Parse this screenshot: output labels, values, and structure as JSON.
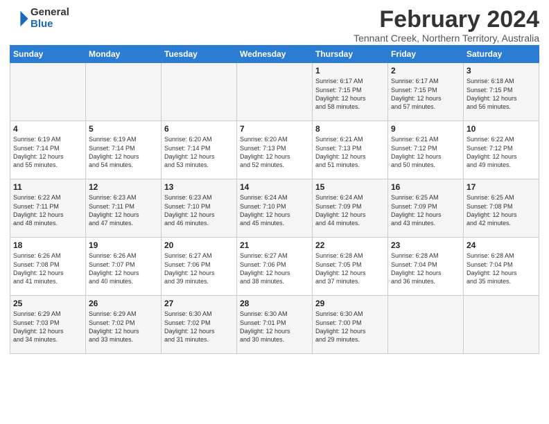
{
  "logo": {
    "text_general": "General",
    "text_blue": "Blue"
  },
  "header": {
    "title": "February 2024",
    "subtitle": "Tennant Creek, Northern Territory, Australia"
  },
  "days_of_week": [
    "Sunday",
    "Monday",
    "Tuesday",
    "Wednesday",
    "Thursday",
    "Friday",
    "Saturday"
  ],
  "weeks": [
    [
      {
        "day": "",
        "info": ""
      },
      {
        "day": "",
        "info": ""
      },
      {
        "day": "",
        "info": ""
      },
      {
        "day": "",
        "info": ""
      },
      {
        "day": "1",
        "info": "Sunrise: 6:17 AM\nSunset: 7:15 PM\nDaylight: 12 hours\nand 58 minutes."
      },
      {
        "day": "2",
        "info": "Sunrise: 6:17 AM\nSunset: 7:15 PM\nDaylight: 12 hours\nand 57 minutes."
      },
      {
        "day": "3",
        "info": "Sunrise: 6:18 AM\nSunset: 7:15 PM\nDaylight: 12 hours\nand 56 minutes."
      }
    ],
    [
      {
        "day": "4",
        "info": "Sunrise: 6:19 AM\nSunset: 7:14 PM\nDaylight: 12 hours\nand 55 minutes."
      },
      {
        "day": "5",
        "info": "Sunrise: 6:19 AM\nSunset: 7:14 PM\nDaylight: 12 hours\nand 54 minutes."
      },
      {
        "day": "6",
        "info": "Sunrise: 6:20 AM\nSunset: 7:14 PM\nDaylight: 12 hours\nand 53 minutes."
      },
      {
        "day": "7",
        "info": "Sunrise: 6:20 AM\nSunset: 7:13 PM\nDaylight: 12 hours\nand 52 minutes."
      },
      {
        "day": "8",
        "info": "Sunrise: 6:21 AM\nSunset: 7:13 PM\nDaylight: 12 hours\nand 51 minutes."
      },
      {
        "day": "9",
        "info": "Sunrise: 6:21 AM\nSunset: 7:12 PM\nDaylight: 12 hours\nand 50 minutes."
      },
      {
        "day": "10",
        "info": "Sunrise: 6:22 AM\nSunset: 7:12 PM\nDaylight: 12 hours\nand 49 minutes."
      }
    ],
    [
      {
        "day": "11",
        "info": "Sunrise: 6:22 AM\nSunset: 7:11 PM\nDaylight: 12 hours\nand 48 minutes."
      },
      {
        "day": "12",
        "info": "Sunrise: 6:23 AM\nSunset: 7:11 PM\nDaylight: 12 hours\nand 47 minutes."
      },
      {
        "day": "13",
        "info": "Sunrise: 6:23 AM\nSunset: 7:10 PM\nDaylight: 12 hours\nand 46 minutes."
      },
      {
        "day": "14",
        "info": "Sunrise: 6:24 AM\nSunset: 7:10 PM\nDaylight: 12 hours\nand 45 minutes."
      },
      {
        "day": "15",
        "info": "Sunrise: 6:24 AM\nSunset: 7:09 PM\nDaylight: 12 hours\nand 44 minutes."
      },
      {
        "day": "16",
        "info": "Sunrise: 6:25 AM\nSunset: 7:09 PM\nDaylight: 12 hours\nand 43 minutes."
      },
      {
        "day": "17",
        "info": "Sunrise: 6:25 AM\nSunset: 7:08 PM\nDaylight: 12 hours\nand 42 minutes."
      }
    ],
    [
      {
        "day": "18",
        "info": "Sunrise: 6:26 AM\nSunset: 7:08 PM\nDaylight: 12 hours\nand 41 minutes."
      },
      {
        "day": "19",
        "info": "Sunrise: 6:26 AM\nSunset: 7:07 PM\nDaylight: 12 hours\nand 40 minutes."
      },
      {
        "day": "20",
        "info": "Sunrise: 6:27 AM\nSunset: 7:06 PM\nDaylight: 12 hours\nand 39 minutes."
      },
      {
        "day": "21",
        "info": "Sunrise: 6:27 AM\nSunset: 7:06 PM\nDaylight: 12 hours\nand 38 minutes."
      },
      {
        "day": "22",
        "info": "Sunrise: 6:28 AM\nSunset: 7:05 PM\nDaylight: 12 hours\nand 37 minutes."
      },
      {
        "day": "23",
        "info": "Sunrise: 6:28 AM\nSunset: 7:04 PM\nDaylight: 12 hours\nand 36 minutes."
      },
      {
        "day": "24",
        "info": "Sunrise: 6:28 AM\nSunset: 7:04 PM\nDaylight: 12 hours\nand 35 minutes."
      }
    ],
    [
      {
        "day": "25",
        "info": "Sunrise: 6:29 AM\nSunset: 7:03 PM\nDaylight: 12 hours\nand 34 minutes."
      },
      {
        "day": "26",
        "info": "Sunrise: 6:29 AM\nSunset: 7:02 PM\nDaylight: 12 hours\nand 33 minutes."
      },
      {
        "day": "27",
        "info": "Sunrise: 6:30 AM\nSunset: 7:02 PM\nDaylight: 12 hours\nand 31 minutes."
      },
      {
        "day": "28",
        "info": "Sunrise: 6:30 AM\nSunset: 7:01 PM\nDaylight: 12 hours\nand 30 minutes."
      },
      {
        "day": "29",
        "info": "Sunrise: 6:30 AM\nSunset: 7:00 PM\nDaylight: 12 hours\nand 29 minutes."
      },
      {
        "day": "",
        "info": ""
      },
      {
        "day": "",
        "info": ""
      }
    ]
  ]
}
